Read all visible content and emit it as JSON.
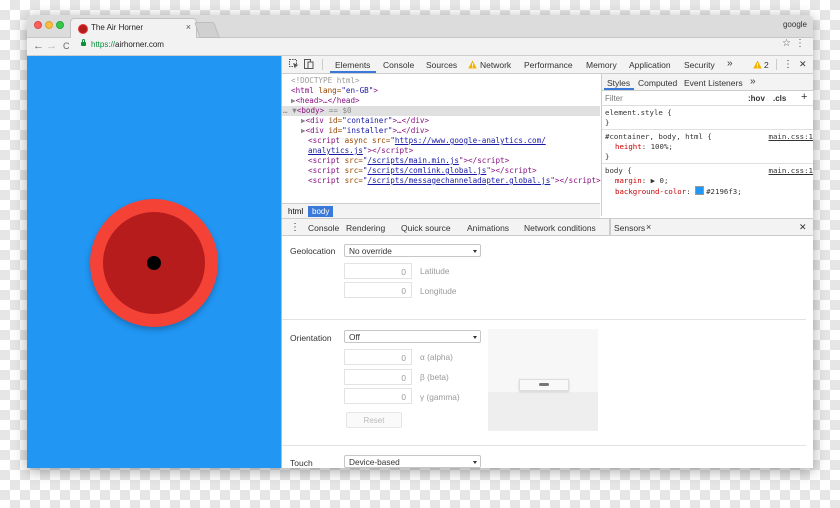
{
  "tab": {
    "title": "The Air Horner",
    "close": "×"
  },
  "profile": "google",
  "address": {
    "scheme": "https://",
    "host": "airhorner.com"
  },
  "nav": {
    "back": "←",
    "forward": "→",
    "reload": "C",
    "star": "☆",
    "menu": "⋮"
  },
  "devtools": {
    "tabs": [
      "Elements",
      "Console",
      "Sources",
      "Network",
      "Performance",
      "Memory",
      "Application",
      "Security"
    ],
    "more": "»",
    "warnings": "2",
    "menu": "⋮",
    "close": "✕",
    "elements_lines": [
      {
        "t": "doctype",
        "text": "<!DOCTYPE html>"
      },
      {
        "t": "html",
        "pre": "<",
        "tag": "html",
        "attr": " lang=",
        "val": "\"en-GB\"",
        "post": ">"
      },
      {
        "t": "head",
        "arrow": "▶",
        "pre": "<",
        "tag": "head",
        "mid": ">…</",
        "tag2": "head",
        "post": ">"
      },
      {
        "t": "body",
        "arrow": "▼",
        "pre": "<",
        "tag": "body",
        "post": ">",
        "extra": " == $0"
      },
      {
        "t": "div1",
        "arrow": "▶",
        "pre": "<",
        "tag": "div",
        "attr": " id=",
        "val": "\"container\"",
        "mid": ">…</",
        "tag2": "div",
        "post": ">"
      },
      {
        "t": "div2",
        "arrow": "▶",
        "pre": "<",
        "tag": "div",
        "attr": " id=",
        "val": "\"installer\"",
        "mid": ">…</",
        "tag2": "div",
        "post": ">"
      },
      {
        "t": "s1",
        "pre": "<",
        "tag": "script",
        "attr": " async src=",
        "q": "\"",
        "link": "https://www.google-analytics.com/"
      },
      {
        "t": "s1b",
        "link": "analytics.js",
        "q": "\"",
        "post": "></",
        "tag2": "script",
        "post2": ">"
      },
      {
        "t": "s2",
        "pre": "<",
        "tag": "script",
        "attr": " src=",
        "q": "\"",
        "link": "/scripts/main.min.js",
        "post": "\"></",
        "tag2": "script",
        "post2": ">"
      },
      {
        "t": "s3",
        "pre": "<",
        "tag": "script",
        "attr": " src=",
        "q": "\"",
        "link": "/scripts/comlink.global.js",
        "post": "\"></",
        "tag2": "script",
        "post2": ">"
      },
      {
        "t": "s4",
        "pre": "<",
        "tag": "script",
        "attr": " src=",
        "q": "\"",
        "link": "/scripts/messagechanneladapter.global.js",
        "post": "\"></",
        "tag2": "script",
        "post2": ">"
      }
    ],
    "breadcrumbs": [
      "html",
      "body"
    ],
    "styles_tabs": [
      "Styles",
      "Computed",
      "Event Listeners",
      "»"
    ],
    "filter": "Filter",
    "hov": ":hov",
    "cls": ".cls",
    "plus": "+",
    "rules": {
      "element_style": "element.style {",
      "close_brace": "}",
      "rule2_selector": "#container, body, html {",
      "rule2_src": "main.css:1",
      "rule2_prop": "height",
      "rule2_val": "100%;",
      "rule3_selector": "body {",
      "rule3_src": "main.css:1",
      "rule3_prop1": "margin",
      "rule3_val1": "0;",
      "rule3_prop2": "background-color",
      "rule3_val2": "#2196f3;",
      "swatch_color": "#2196f3"
    },
    "drawer_tabs": [
      "Console",
      "Rendering",
      "Quick source",
      "Animations",
      "Network conditions",
      "Sensors"
    ],
    "drawer_menu": "⋮",
    "drawer_close": "✕",
    "sensors": {
      "geolocation_label": "Geolocation",
      "geolocation_value": "No override",
      "latitude_value": "0",
      "latitude_label": "Latitude",
      "longitude_value": "0",
      "longitude_label": "Longitude",
      "orientation_label": "Orientation",
      "orientation_value": "Off",
      "alpha_value": "0",
      "alpha_label": "α (alpha)",
      "beta_value": "0",
      "beta_label": "β (beta)",
      "gamma_value": "0",
      "gamma_label": "γ (gamma)",
      "reset_label": "Reset",
      "touch_label": "Touch",
      "touch_value": "Device-based"
    }
  },
  "colors": {
    "page_bg": "#2196f3",
    "horn_outer": "#f44336",
    "horn_inner": "#b71c1c",
    "accent": "#3879d9"
  }
}
